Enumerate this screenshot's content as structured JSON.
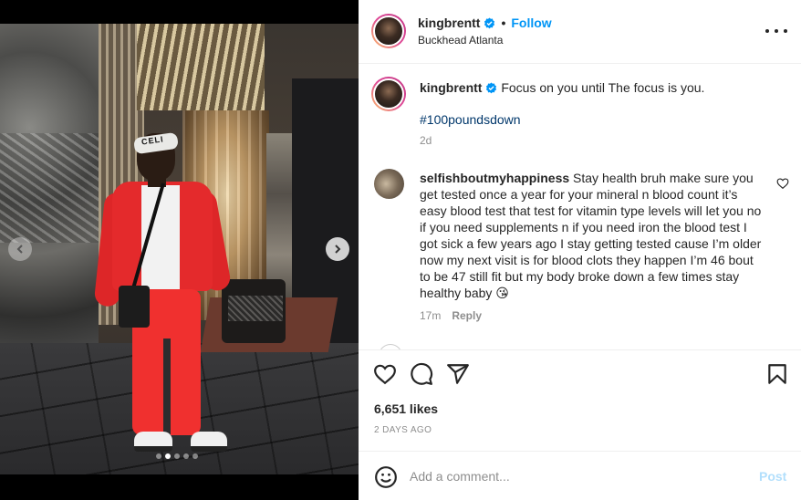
{
  "post": {
    "username": "kingbrentt",
    "follow_label": "Follow",
    "separator": "•",
    "location": "Buckhead Atlanta",
    "headband_text": "CELI",
    "caption": {
      "text": "Focus on you until The focus is you.",
      "hashtag": "#100poundsdown",
      "time": "2d"
    },
    "carousel": {
      "total": 5,
      "active_index": 1
    }
  },
  "comment": {
    "username": "selfishboutmyhappiness",
    "text": "Stay health bruh make sure you get tested once a year for your mineral n blood count it’s easy blood test that test for vitamin type levels will let you no if you need supplements n if you need iron the blood test I got sick a few years ago I stay getting tested cause I’m older now my next visit is for blood clots they happen I’m 46 bout to be 47 still fit but my body broke down a few times stay healthy baby 😘",
    "time": "17m",
    "reply_label": "Reply"
  },
  "footer": {
    "likes": "6,651 likes",
    "time_ago": "2 DAYS AGO",
    "comment_placeholder": "Add a comment...",
    "post_label": "Post"
  },
  "colors": {
    "link_blue": "#0095f6",
    "hashtag": "#00376b",
    "muted": "#8e8e8e",
    "post_disabled": "#b2dffc"
  },
  "icons": [
    "chevron-left-icon",
    "chevron-right-icon",
    "verified-badge-icon",
    "more-options-icon",
    "heart-icon",
    "comment-icon",
    "share-icon",
    "bookmark-icon",
    "emoji-icon"
  ]
}
